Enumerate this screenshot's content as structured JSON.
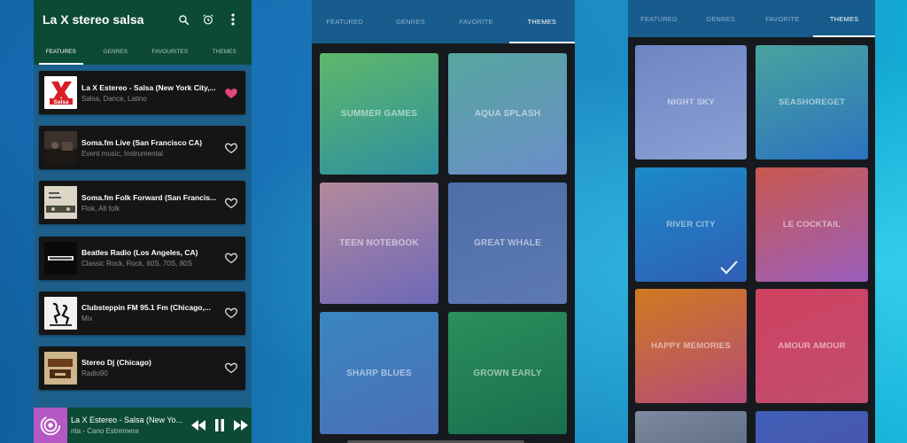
{
  "app": {
    "title": "La X stereo salsa",
    "tabs": [
      "FEATURES",
      "GENRES",
      "FAVOURITES",
      "THEMES"
    ],
    "active_tab": 0
  },
  "stations": [
    {
      "name": "La X Estereo - Salsa (New York City,...",
      "genre": "Salsa, Dance, Latino",
      "favorite": true,
      "thumb": "la-x-salsa-logo"
    },
    {
      "name": "Soma.fm Live (San Francisco CA)",
      "genre": "Event music, Instrumental",
      "favorite": false,
      "thumb": "soma-live-photo"
    },
    {
      "name": "Soma.fm Folk Forward (San Francis...",
      "genre": "Flok, Alt folk",
      "favorite": false,
      "thumb": "folk-forward-logo"
    },
    {
      "name": "Beatles Radio (Los Angeles, CA)",
      "genre": "Classic Rock, Rock, 60S, 70S, 80S",
      "favorite": false,
      "thumb": "beatles-radio-logo"
    },
    {
      "name": " Clubsteppin FM 95.1 Fm (Chicago,...",
      "genre": "Mix",
      "favorite": false,
      "thumb": "clubsteppin-logo"
    },
    {
      "name": "Stereo Dj (Chicago)",
      "genre": "Radio90",
      "favorite": false,
      "thumb": "stereo-dj-logo"
    }
  ],
  "player": {
    "title": "La X Estereo - Salsa (New Yo...",
    "subtitle": "nta - Cano Estremera"
  },
  "themes_screen_1": {
    "tabs": [
      "FEATURED",
      "GENRES",
      "FAVORITE",
      "THEMES"
    ],
    "active_tab": 3,
    "tiles": [
      {
        "label": "SUMMER GAMES",
        "colors": [
          "#5fb86a",
          "#2e8fa0"
        ]
      },
      {
        "label": "AQUA SPLASH",
        "colors": [
          "#57a6a0",
          "#6a8ec8"
        ]
      },
      {
        "label": "TEEN NOTEBOOK",
        "colors": [
          "#b48a9c",
          "#6e68b8"
        ]
      },
      {
        "label": "GREAT WHALE",
        "colors": [
          "#4e6ea6",
          "#5c79b4"
        ]
      },
      {
        "label": "SHARP BLUES",
        "colors": [
          "#3a86c0",
          "#4b6fb8"
        ]
      },
      {
        "label": "GROWN EARLY",
        "colors": [
          "#2b8f5c",
          "#1a6e4e"
        ]
      }
    ]
  },
  "themes_screen_2": {
    "tabs": [
      "FEATURED",
      "GENRES",
      "FAVORITE",
      "THEMES"
    ],
    "active_tab": 3,
    "selected": "RIVER CITY",
    "tiles": [
      {
        "label": "NIGHT SKY",
        "colors": [
          "#6d85c4",
          "#8aa1d4"
        ]
      },
      {
        "label": "SEASHOREGET",
        "colors": [
          "#4aa39e",
          "#2a73c0"
        ]
      },
      {
        "label": "RIVER CITY",
        "colors": [
          "#1b8ac7",
          "#2f5fb6"
        ]
      },
      {
        "label": "LE COCKTAIL",
        "colors": [
          "#c9584e",
          "#9b5fbd"
        ]
      },
      {
        "label": "HAPPY MEMORIES",
        "colors": [
          "#d07a1f",
          "#b64a79"
        ]
      },
      {
        "label": "AMOUR AMOUR",
        "colors": [
          "#cf4161",
          "#c24d6e"
        ]
      },
      {
        "label": "",
        "colors": [
          "#7d8aa0",
          "#5a6a82"
        ]
      },
      {
        "label": "",
        "colors": [
          "#3f5fb6",
          "#4b54b0"
        ]
      }
    ]
  }
}
